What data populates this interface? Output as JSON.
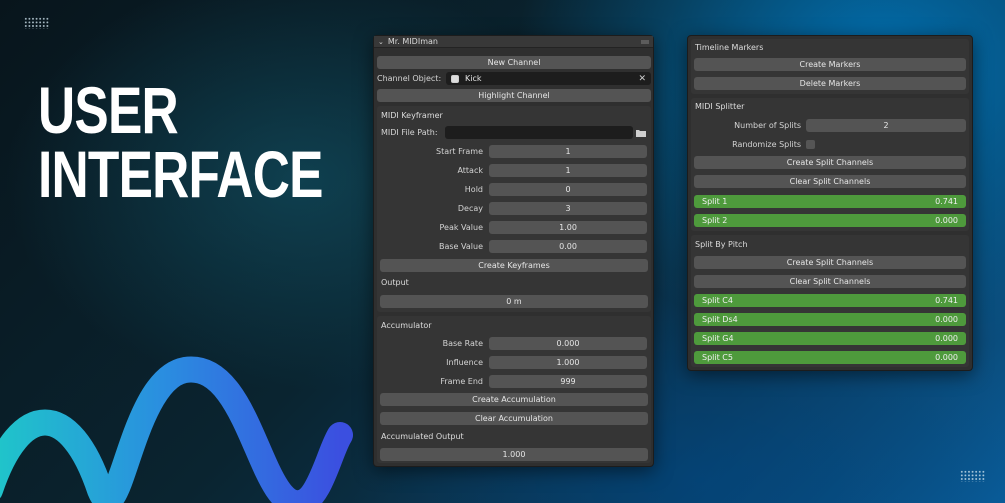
{
  "hero": {
    "line1": "USER",
    "line2": "INTERFACE"
  },
  "main_panel": {
    "title": "Mr. MIDIman",
    "new_channel": "New Channel",
    "channel_object_label": "Channel Object:",
    "channel_object_value": "Kick",
    "highlight_channel": "Highlight Channel",
    "keyframer": {
      "title": "MIDI Keyframer",
      "file_path_label": "MIDI File Path:",
      "file_path_value": "",
      "fields": [
        {
          "label": "Start Frame",
          "value": "1"
        },
        {
          "label": "Attack",
          "value": "1"
        },
        {
          "label": "Hold",
          "value": "0"
        },
        {
          "label": "Decay",
          "value": "3"
        },
        {
          "label": "Peak Value",
          "value": "1.00"
        },
        {
          "label": "Base Value",
          "value": "0.00"
        }
      ],
      "create_keyframes": "Create Keyframes",
      "output_label": "Output",
      "output_value": "0 m"
    },
    "accumulator": {
      "title": "Accumulator",
      "fields": [
        {
          "label": "Base Rate",
          "value": "0.000"
        },
        {
          "label": "Influence",
          "value": "1.000"
        },
        {
          "label": "Frame End",
          "value": "999"
        }
      ],
      "create_accumulation": "Create Accumulation",
      "clear_accumulation": "Clear Accumulation",
      "accumulated_label": "Accumulated Output",
      "accumulated_value": "1.000"
    }
  },
  "right_panel": {
    "timeline": {
      "title": "Timeline Markers",
      "create": "Create Markers",
      "delete": "Delete Markers"
    },
    "splitter": {
      "title": "MIDI Splitter",
      "num_splits_label": "Number of Splits",
      "num_splits_value": "2",
      "randomize_label": "Randomize Splits",
      "randomize_checked": false,
      "create": "Create Split Channels",
      "clear": "Clear Split Channels",
      "splits": [
        {
          "name": "Split 1",
          "value": "0.741"
        },
        {
          "name": "Split 2",
          "value": "0.000"
        }
      ]
    },
    "pitch": {
      "title": "Split By Pitch",
      "create": "Create Split Channels",
      "clear": "Clear Split Channels",
      "splits": [
        {
          "name": "Split C4",
          "value": "0.741"
        },
        {
          "name": "Split Ds4",
          "value": "0.000"
        },
        {
          "name": "Split G4",
          "value": "0.000"
        },
        {
          "name": "Split C5",
          "value": "0.000"
        }
      ]
    }
  },
  "colors": {
    "accent_green": "#4e9a3c",
    "panel_bg": "#2f2f2f",
    "button_bg": "#545454",
    "wave_gradient_start": "#1fc7c9",
    "wave_gradient_end": "#3b4fe0"
  },
  "icons": [
    "chevron-down-icon",
    "grip-icon",
    "object-icon",
    "close-icon",
    "folder-icon",
    "checkbox-icon"
  ]
}
